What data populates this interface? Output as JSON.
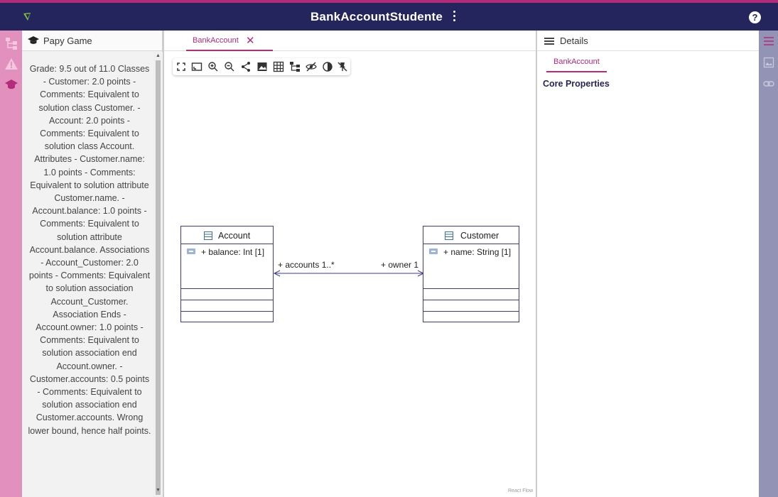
{
  "app": {
    "title": "BankAccountStudente",
    "help_label": "?"
  },
  "colors": {
    "topbar": "#25255e",
    "accent": "#b42b79",
    "left_rail": "#e290bd",
    "right_rail": "#9293b5",
    "uml_border": "#3b3b8a"
  },
  "left_rail": {
    "icons": [
      "diagram-tree-icon",
      "warning-icon",
      "graduation-cap-icon"
    ]
  },
  "game_panel": {
    "title": "Papy Game",
    "grade_text": "Grade: 9.5 out of 11.0 Classes - Customer: 2.0 points - Comments: Equivalent to solution class Customer. - Account: 2.0 points - Comments: Equivalent to solution class Account. Attributes - Customer.name: 1.0 points - Comments: Equivalent to solution attribute Customer.name. - Account.balance: 1.0 points - Comments: Equivalent to solution attribute Account.balance. Associations - Account_Customer: 2.0 points - Comments: Equivalent to solution association Account_Customer. Association Ends - Account.owner: 1.0 points - Comments: Equivalent to solution association end Account.owner. - Customer.accounts: 0.5 points - Comments: Equivalent to solution association end Customer.accounts. Wrong lower bound, hence half points."
  },
  "editor": {
    "tab_label": "BankAccount",
    "tab_close": "✕",
    "attribution": "React Flow",
    "toolbar_tools": [
      "fullscreen-icon",
      "fit-view-icon",
      "zoom-in-icon",
      "zoom-out-icon",
      "share-icon",
      "export-image-icon",
      "grid-icon",
      "layout-icon",
      "hide-icon",
      "contrast-icon",
      "pin-off-icon"
    ]
  },
  "diagram": {
    "classes": [
      {
        "name": "Account",
        "attribute": "+ balance: Int [1]"
      },
      {
        "name": "Customer",
        "attribute": "+ name: String [1]"
      }
    ],
    "association": {
      "left_label": "+ accounts 1..*",
      "right_label": "+ owner 1"
    }
  },
  "details": {
    "title": "Details",
    "tab_label": "BankAccount",
    "section_title": "Core Properties"
  },
  "right_rail": {
    "icons": [
      "hamburger-menu-icon",
      "image-icon",
      "link-icon"
    ]
  }
}
